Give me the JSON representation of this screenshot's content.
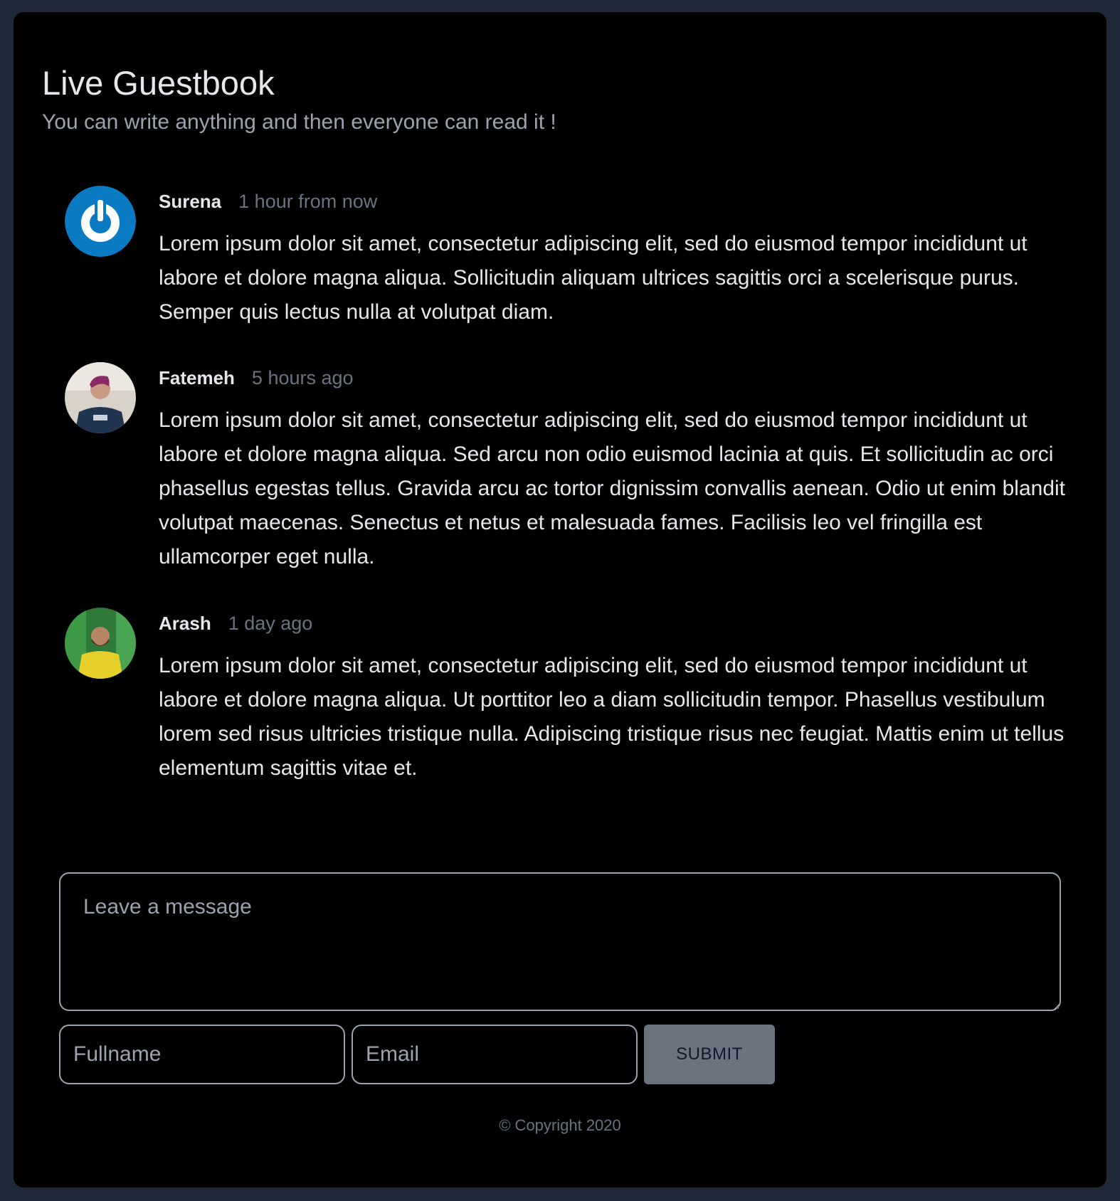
{
  "header": {
    "title": "Live Guestbook",
    "subtitle": "You can write anything and then everyone can read it !"
  },
  "comments": [
    {
      "author": "Surena",
      "time": "1 hour from now",
      "text": "Lorem ipsum dolor sit amet, consectetur adipiscing elit, sed do eiusmod tempor incididunt ut labore et dolore magna aliqua. Sollicitudin aliquam ultrices sagittis orci a scelerisque purus. Semper quis lectus nulla at volutpat diam.",
      "avatar": "power-logo-avatar"
    },
    {
      "author": "Fatemeh",
      "time": "5 hours ago",
      "text": "Lorem ipsum dolor sit amet, consectetur adipiscing elit, sed do eiusmod tempor incididunt ut labore et dolore magna aliqua. Sed arcu non odio euismod lacinia at quis. Et sollicitudin ac orci phasellus egestas tellus. Gravida arcu ac tortor dignissim convallis aenean. Odio ut enim blandit volutpat maecenas. Senectus et netus et malesuada fames. Facilisis leo vel fringilla est ullamcorper eget nulla.",
      "avatar": "photo-avatar"
    },
    {
      "author": "Arash",
      "time": "1 day ago",
      "text": "Lorem ipsum dolor sit amet, consectetur adipiscing elit, sed do eiusmod tempor incididunt ut labore et dolore magna aliqua. Ut porttitor leo a diam sollicitudin tempor. Phasellus vestibulum lorem sed risus ultricies tristique nulla. Adipiscing tristique risus nec feugiat. Mattis enim ut tellus elementum sagittis vitae et.",
      "avatar": "photo-avatar"
    }
  ],
  "form": {
    "message_placeholder": "Leave a message",
    "fullname_placeholder": "Fullname",
    "email_placeholder": "Email",
    "submit_label": "SUBMIT"
  },
  "footer": {
    "copyright": "© Copyright 2020"
  },
  "colors": {
    "page_background": "#1f2937",
    "card_background": "#000000",
    "logo_blue": "#0a7ac2",
    "submit_background": "#6b7280"
  }
}
